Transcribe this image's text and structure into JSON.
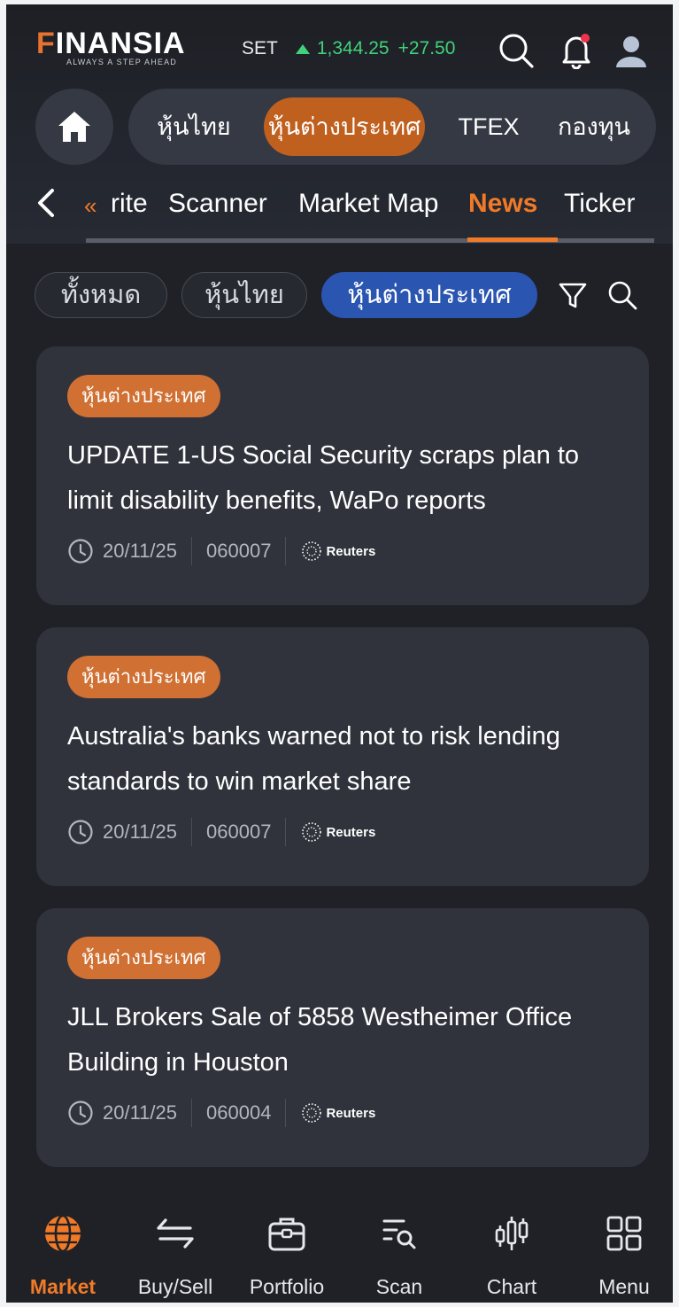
{
  "header": {
    "logo_text": "INANSIA",
    "logo_initial": "F",
    "logo_tagline": "ALWAYS A STEP AHEAD",
    "index_name": "SET",
    "index_value": "1,344.25",
    "index_change": "+27.50",
    "index_direction": "up"
  },
  "categories": [
    {
      "label": "หุ้นไทย",
      "active": false
    },
    {
      "label": "หุ้นต่างประเทศ",
      "active": true
    },
    {
      "label": "TFEX",
      "active": false
    },
    {
      "label": "กองทุน",
      "active": false
    }
  ],
  "subnav": {
    "chevron": "«",
    "items": [
      {
        "label": "rite",
        "active": false
      },
      {
        "label": "Scanner",
        "active": false
      },
      {
        "label": "Market Map",
        "active": false
      },
      {
        "label": "News",
        "active": true
      },
      {
        "label": "Ticker",
        "active": false
      }
    ]
  },
  "filters": [
    {
      "label": "ทั้งหมด",
      "active": false
    },
    {
      "label": "หุ้นไทย",
      "active": false
    },
    {
      "label": "หุ้นต่างประเทศ",
      "active": true
    }
  ],
  "news": [
    {
      "badge": "หุ้นต่างประเทศ",
      "headline": "UPDATE 1-US Social Security scraps plan to limit disability benefits, WaPo reports",
      "date": "20/11/25",
      "time": "060007",
      "source": "Reuters"
    },
    {
      "badge": "หุ้นต่างประเทศ",
      "headline": "Australia's banks warned not to risk lending standards to win market share",
      "date": "20/11/25",
      "time": "060007",
      "source": "Reuters"
    },
    {
      "badge": "หุ้นต่างประเทศ",
      "headline": "JLL Brokers Sale of 5858 Westheimer Office Building in Houston",
      "date": "20/11/25",
      "time": "060004",
      "source": "Reuters"
    }
  ],
  "bottom_nav": [
    {
      "label": "Market",
      "icon": "globe-icon",
      "active": true
    },
    {
      "label": "Buy/Sell",
      "icon": "swap-arrows-icon",
      "active": false
    },
    {
      "label": "Portfolio",
      "icon": "briefcase-icon",
      "active": false
    },
    {
      "label": "Scan",
      "icon": "scan-list-icon",
      "active": false
    },
    {
      "label": "Chart",
      "icon": "candlestick-icon",
      "active": false
    },
    {
      "label": "Menu",
      "icon": "grid-menu-icon",
      "active": false
    }
  ],
  "colors": {
    "accent": "#f07a28",
    "badge": "#d07033",
    "active_filter": "#2a55b0",
    "up": "#3fd27a",
    "background": "#1f2127",
    "card": "#30333c"
  }
}
